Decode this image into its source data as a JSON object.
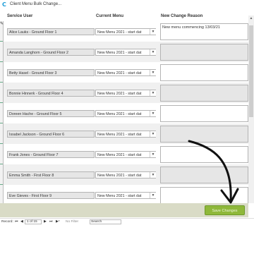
{
  "window": {
    "title": "Client Menu Bulk Change..."
  },
  "columns": {
    "service_user": "Service User",
    "current_menu": "Current Menu",
    "new_change_reason": "New Change Reason"
  },
  "rows": [
    {
      "service_user": "Alice Lauks - Ground Floor 1",
      "current_menu": "New Menu 2021 - start dat",
      "reason": "New menu commencing  13/03/21"
    },
    {
      "service_user": "Amanda Langhorn - Ground Floor 2",
      "current_menu": "New Menu 2021 - start dat",
      "reason": ""
    },
    {
      "service_user": "Betty Hasel - Ground Floor 3",
      "current_menu": "New Menu 2021 - start dat",
      "reason": ""
    },
    {
      "service_user": "Bonnie Hinnerk - Ground Floor 4",
      "current_menu": "New Menu 2021 - start dat",
      "reason": ""
    },
    {
      "service_user": "Doreen Hache - Ground Floor 5",
      "current_menu": "New Menu 2021 - start dat",
      "reason": ""
    },
    {
      "service_user": "Issabel Jackson - Ground Floor 6",
      "current_menu": "New Menu 2021 - start dat",
      "reason": ""
    },
    {
      "service_user": "Frank Jones - Ground Floor 7",
      "current_menu": "New Menu 2021 - start dat",
      "reason": ""
    },
    {
      "service_user": "Emma Smith - First Floor 8",
      "current_menu": "New Menu 2021 - start dat",
      "reason": ""
    },
    {
      "service_user": "Eve Gieves - First Floor 9",
      "current_menu": "New Menu 2021 - start dat",
      "reason": ""
    }
  ],
  "footer": {
    "save_label": "Save Changes"
  },
  "navigation": {
    "record_label": "Record:",
    "first": "⏮",
    "prev": "◀",
    "position": "1 of 15",
    "next": "▶",
    "last": "⏭",
    "new": "▶*",
    "filter_label": "No Filter",
    "search_label": "Search"
  },
  "colors": {
    "accent": "#8fb83a",
    "footer_bg": "#d9dbc6",
    "app_icon": "#1a9bd7"
  }
}
